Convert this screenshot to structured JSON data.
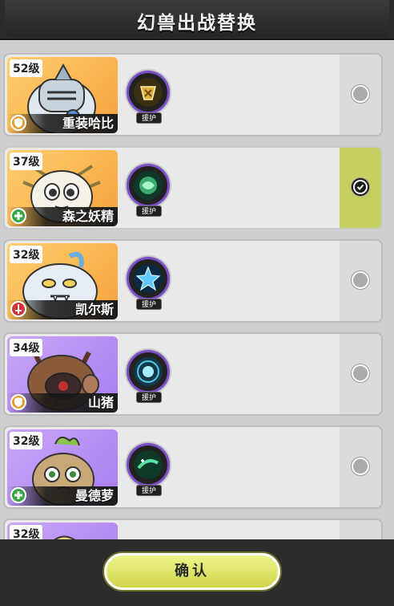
{
  "header": {
    "title": "幻兽出战替换"
  },
  "cards": [
    {
      "level": "52级",
      "name": "重装哈比",
      "role": "shield",
      "bg": "orange",
      "skill_tag": "援护",
      "skill_color": "#e0b040",
      "selected": false
    },
    {
      "level": "37级",
      "name": "森之妖精",
      "role": "heal",
      "bg": "orange",
      "skill_tag": "援护",
      "skill_color": "#4fd08a",
      "selected": true
    },
    {
      "level": "32级",
      "name": "凯尔斯",
      "role": "attack",
      "bg": "orange",
      "skill_tag": "援护",
      "skill_color": "#5fc8ff",
      "selected": false
    },
    {
      "level": "34级",
      "name": "山猪",
      "role": "shield",
      "bg": "purple",
      "skill_tag": "援护",
      "skill_color": "#58c8e8",
      "selected": false
    },
    {
      "level": "32级",
      "name": "曼德萝",
      "role": "heal",
      "bg": "purple",
      "skill_tag": "援护",
      "skill_color": "#5ae0a0",
      "selected": false
    },
    {
      "level": "32级",
      "name": "",
      "role": "",
      "bg": "purple",
      "skill_tag": "",
      "skill_color": "#888",
      "selected": false
    }
  ],
  "confirm_label": "确认",
  "colors": {
    "selected_bg": "#c7cf63",
    "confirm_bg": "#dfe46a",
    "skill_border": "#7a4fc8"
  }
}
